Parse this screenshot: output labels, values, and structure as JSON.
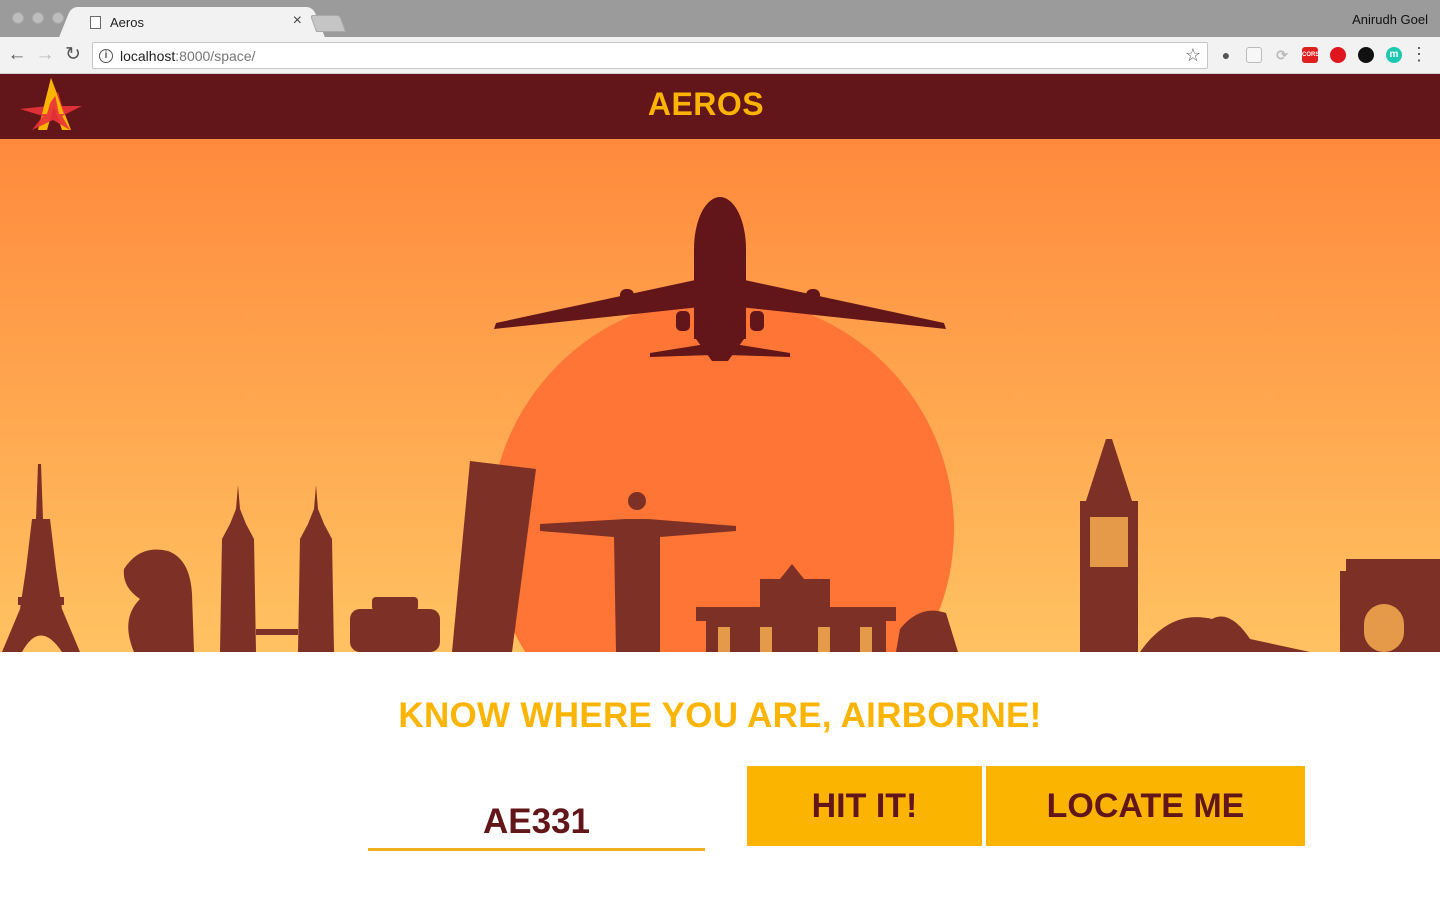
{
  "browser": {
    "tab_title": "Aeros",
    "tab_close": "×",
    "profile_name": "Anirudh Goel",
    "url_host": "localhost",
    "url_path": ":8000/space/",
    "nav": {
      "back": "←",
      "forward": "→",
      "reload": "↻"
    },
    "extensions": [
      {
        "icon": "lightbulb-icon"
      },
      {
        "icon": "reader-icon"
      },
      {
        "icon": "sync-icon"
      },
      {
        "icon": "cors-icon",
        "label": "CORS"
      },
      {
        "icon": "opera-icon"
      },
      {
        "icon": "whatsapp-icon"
      },
      {
        "icon": "m-icon",
        "label": "m"
      }
    ]
  },
  "header": {
    "title": "AEROS",
    "logo": "aeros-star-logo"
  },
  "hero": {
    "illustration": "airplane-sunset-skyline",
    "colors": {
      "sky_top": "#ff8a3d",
      "sky_bottom": "#ffc060",
      "sun": "#ff7536",
      "silhouette": "#7c3026",
      "plane": "#621619"
    }
  },
  "main": {
    "tagline": "KNOW WHERE YOU ARE, AIRBORNE!",
    "flight_input_value": "AE331",
    "hit_button": "HIT IT!",
    "locate_button": "LOCATE ME"
  },
  "colors": {
    "brand_dark": "#621619",
    "brand_yellow": "#fbb400"
  }
}
